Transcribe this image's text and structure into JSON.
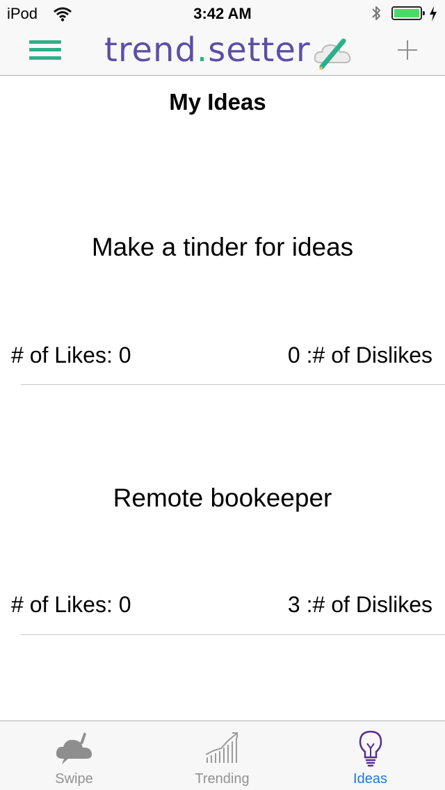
{
  "status_bar": {
    "carrier": "iPod",
    "time": "3:42 AM",
    "battery_color": "#4cd964"
  },
  "nav_bar": {
    "logo_word_1": "trend",
    "logo_dot": ".",
    "logo_word_2": "setter",
    "accent_color": "#2db08a",
    "brand_color": "#5b4fa6",
    "menu_icon": "hamburger-icon",
    "add_icon": "plus-icon"
  },
  "page": {
    "title": "My Ideas"
  },
  "ideas": [
    {
      "title": "Make a tinder for ideas",
      "likes_text": "# of Likes: 0",
      "dislikes_text": "0 :# of Dislikes"
    },
    {
      "title": "Remote bookeeper",
      "likes_text": "# of Likes: 0",
      "dislikes_text": "3 :# of Dislikes"
    }
  ],
  "tab_bar": {
    "tabs": [
      {
        "label": "Swipe",
        "icon": "cloud-icon"
      },
      {
        "label": "Trending",
        "icon": "trending-chart-icon"
      },
      {
        "label": "Ideas",
        "icon": "lightbulb-icon",
        "active": true
      }
    ],
    "active_color": "#1a7ae0",
    "inactive_color": "#929292"
  }
}
